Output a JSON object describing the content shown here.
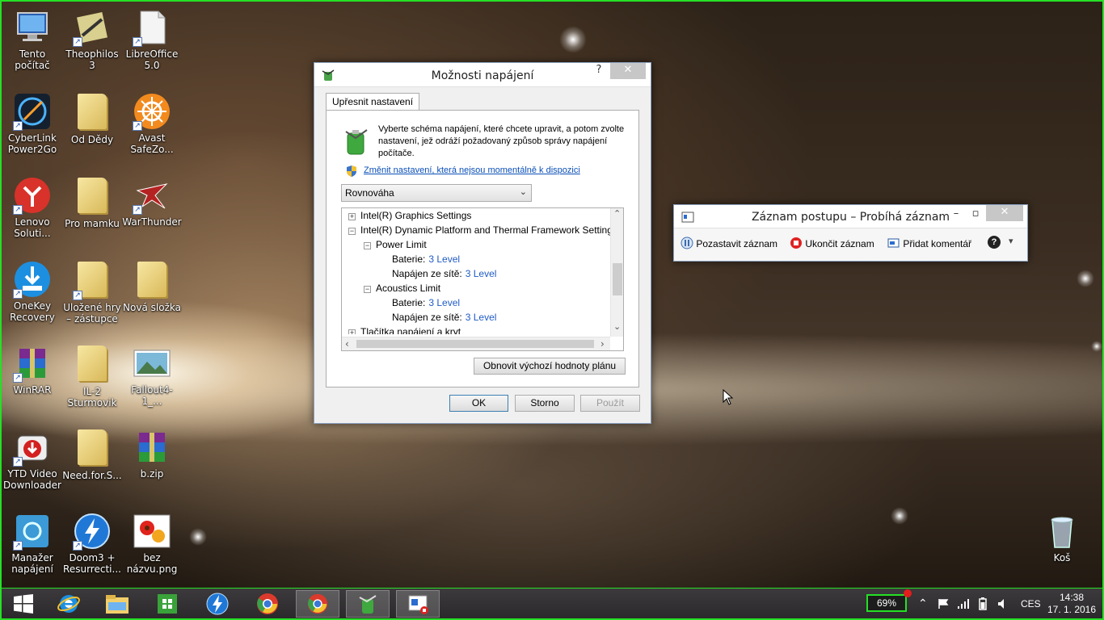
{
  "desktop": {
    "icons": [
      {
        "label": "Tento počítač",
        "icon": "computer-icon"
      },
      {
        "label": "Theophilos 3",
        "icon": "game-icon"
      },
      {
        "label": "LibreOffice 5.0",
        "icon": "document-icon"
      },
      {
        "label": "CyberLink Power2Go",
        "icon": "disc-burn-icon"
      },
      {
        "label": "Od Dědy",
        "icon": "folder-icon"
      },
      {
        "label": "Avast SafeZo...",
        "icon": "ship-wheel-icon"
      },
      {
        "label": "Lenovo Soluti...",
        "icon": "lenovo-solutions-icon"
      },
      {
        "label": "Pro mamku",
        "icon": "folder-icon"
      },
      {
        "label": "WarThunder",
        "icon": "plane-icon"
      },
      {
        "label": "OneKey Recovery",
        "icon": "recovery-icon"
      },
      {
        "label": "Uložené hry – zástupce",
        "icon": "chess-folder-icon"
      },
      {
        "label": "Nová složka",
        "icon": "folder-icon"
      },
      {
        "label": "WinRAR",
        "icon": "winrar-icon"
      },
      {
        "label": "IL-2 Sturmovik",
        "icon": "folder-icon"
      },
      {
        "label": "Fallout4-1_...",
        "icon": "image-icon"
      },
      {
        "label": "YTD Video Downloader",
        "icon": "download-icon"
      },
      {
        "label": "Need.for.S...",
        "icon": "folder-icon"
      },
      {
        "label": "b.zip",
        "icon": "archive-icon"
      },
      {
        "label": "Manažer napájení",
        "icon": "power-manager-icon"
      },
      {
        "label": "Doom3 + Resurrecti...",
        "icon": "lightning-icon"
      },
      {
        "label": "bez názvu.png",
        "icon": "flower-image-icon"
      },
      {
        "label": "Koš",
        "icon": "recycle-bin-icon"
      }
    ]
  },
  "power_dialog": {
    "title": "Možnosti napájení",
    "help": "?",
    "close": "✕",
    "tab": "Upřesnit nastavení",
    "description": "Vyberte schéma napájení, které chcete upravit, a potom zvolte nastavení, jež odráží požadovaný způsob správy napájení počítače.",
    "link": "Změnit nastavení, která nejsou momentálně k dispozici",
    "scheme_selected": "Rovnováha",
    "tree": [
      {
        "expander": "+",
        "label": "Intel(R) Graphics Settings",
        "value": ""
      },
      {
        "expander": "−",
        "label": "Intel(R) Dynamic Platform and Thermal Framework Setting",
        "value": ""
      },
      {
        "expander": "−",
        "label": "Power Limit",
        "value": ""
      },
      {
        "expander": "",
        "label": "Baterie:",
        "value": "3 Level"
      },
      {
        "expander": "",
        "label": "Napájen ze sítě:",
        "value": "3 Level"
      },
      {
        "expander": "−",
        "label": "Acoustics Limit",
        "value": ""
      },
      {
        "expander": "",
        "label": "Baterie:",
        "value": "3 Level"
      },
      {
        "expander": "",
        "label": "Napájen ze sítě:",
        "value": "3 Level"
      },
      {
        "expander": "+",
        "label": "Tlačítka napájení a kryt",
        "value": ""
      }
    ],
    "restore_button": "Obnovit výchozí hodnoty plánu",
    "ok": "OK",
    "cancel": "Storno",
    "apply": "Použít"
  },
  "recorder": {
    "title": "Záznam postupu – Probíhá záznam",
    "pause": "Pozastavit záznam",
    "stop": "Ukončit záznam",
    "comment": "Přidat komentář",
    "help": "?"
  },
  "taskbar": {
    "battery": "69%",
    "language": "CES",
    "time": "14:38",
    "date": "17. 1. 2016"
  }
}
